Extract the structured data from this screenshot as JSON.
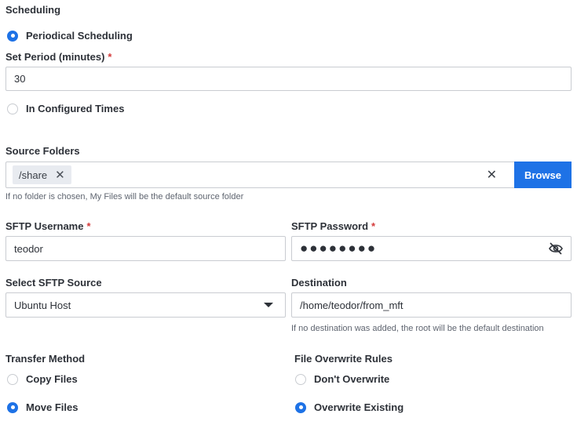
{
  "scheduling": {
    "title": "Scheduling",
    "periodical_label": "Periodical Scheduling",
    "period_label": "Set Period (minutes)",
    "period_value": "30",
    "configured_label": "In Configured Times"
  },
  "source": {
    "label": "Source Folders",
    "chip": "/share",
    "browse_label": "Browse",
    "hint": "If no folder is chosen, My Files will be the default source folder"
  },
  "sftp": {
    "username_label": "SFTP Username",
    "username_value": "teodor",
    "password_label": "SFTP Password",
    "password_mask": "●●●●●●●●",
    "source_label": "Select SFTP Source",
    "source_value": "Ubuntu Host"
  },
  "destination": {
    "label": "Destination",
    "value": "/home/teodor/from_mft",
    "hint": "If no destination was added, the root will be the default destination"
  },
  "transfer": {
    "title": "Transfer Method",
    "copy_label": "Copy Files",
    "move_label": "Move Files"
  },
  "overwrite": {
    "title": "File Overwrite Rules",
    "dont_label": "Don't Overwrite",
    "existing_label": "Overwrite Existing"
  },
  "colors": {
    "accent": "#1e72e6",
    "required": "#d43b3b",
    "border": "#c9ccd1"
  }
}
